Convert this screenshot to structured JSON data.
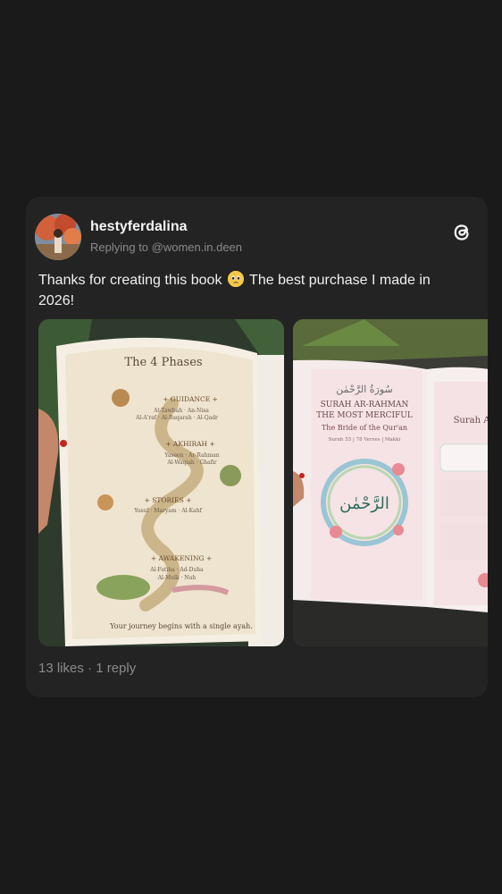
{
  "post": {
    "username": "hestyferdalina",
    "replying_to": "Replying to @women.in.deen",
    "text_part1": "Thanks for creating this book",
    "emoji": "pleading-face",
    "text_part2": " The best purchase I made in 2026!",
    "likes": "13 likes",
    "separator": " · ",
    "replies": "1 reply"
  },
  "images": {
    "left_page": {
      "title": "The 4 Phases",
      "phases": [
        {
          "name": "+ GUIDANCE +",
          "surahs": "At-Tawbah · An-Nisa\nAl-A'raf · Al-Baqarah · Al-Qadr"
        },
        {
          "name": "+ AKHIRAH +",
          "surahs": "Yaseen · Ar-Rahman\nAl-Waqiah · Ghafir"
        },
        {
          "name": "+ STORIES +",
          "surahs": "Yusuf · Maryam · Al-Kahf"
        },
        {
          "name": "+ AWAKENING +",
          "surahs": "Al-Fatiha · Ad-Duha\nAl-Mulk · Nuh"
        }
      ],
      "footer": "Your journey begins with a single ayah."
    },
    "right_page": {
      "arabic_title": "سُورَةُ الرَّحْمٰن",
      "title1": "SURAH AR-RAHMAN",
      "title2": "THE MOST MERCIFUL",
      "subtitle": "The Bride of the Qur'an",
      "meta": "Surah 55 | 78 Verses | Makki",
      "arabic_center": "الرَّحْمٰن",
      "right_page_title": "Surah A"
    }
  },
  "colors": {
    "background": "#1a1a1a",
    "card": "#232323",
    "muted": "#8a8a8a"
  }
}
